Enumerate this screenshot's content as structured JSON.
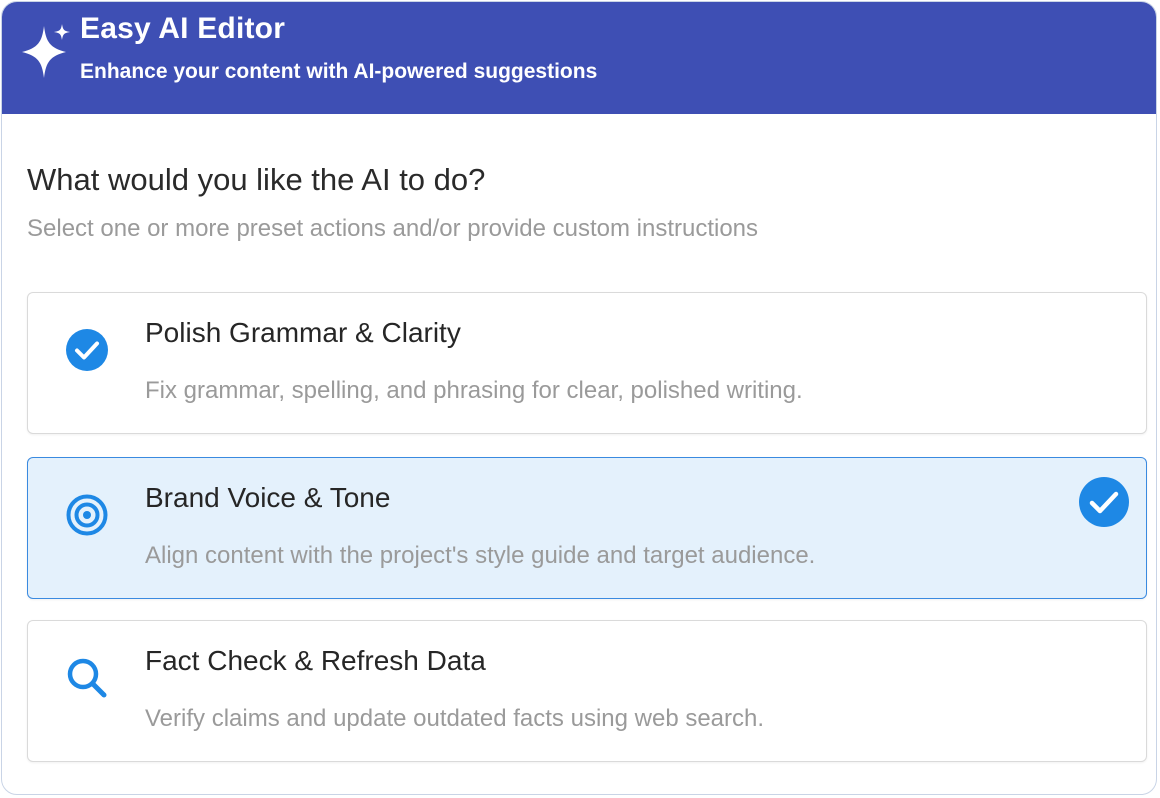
{
  "header": {
    "title": "Easy AI Editor",
    "subtitle": "Enhance your content with AI-powered suggestions",
    "icon": "sparkle-icon",
    "background_color": "#3e4fb4"
  },
  "prompt": {
    "question": "What would you like the AI to do?",
    "hint": "Select one or more preset actions and/or provide custom instructions"
  },
  "options": [
    {
      "title": "Polish Grammar & Clarity",
      "description": "Fix grammar, spelling, and phrasing for clear, polished writing.",
      "icon": "check-circle-icon",
      "selected": false
    },
    {
      "title": "Brand Voice & Tone",
      "description": "Align content with the project's style guide and target audience.",
      "icon": "target-icon",
      "selected": true
    },
    {
      "title": "Fact Check & Refresh Data",
      "description": "Verify claims and update outdated facts using web search.",
      "icon": "search-icon",
      "selected": false
    }
  ],
  "colors": {
    "accent": "#1e88e5",
    "selected_background": "#e4f1fc",
    "selected_border": "#3a8ae0"
  }
}
